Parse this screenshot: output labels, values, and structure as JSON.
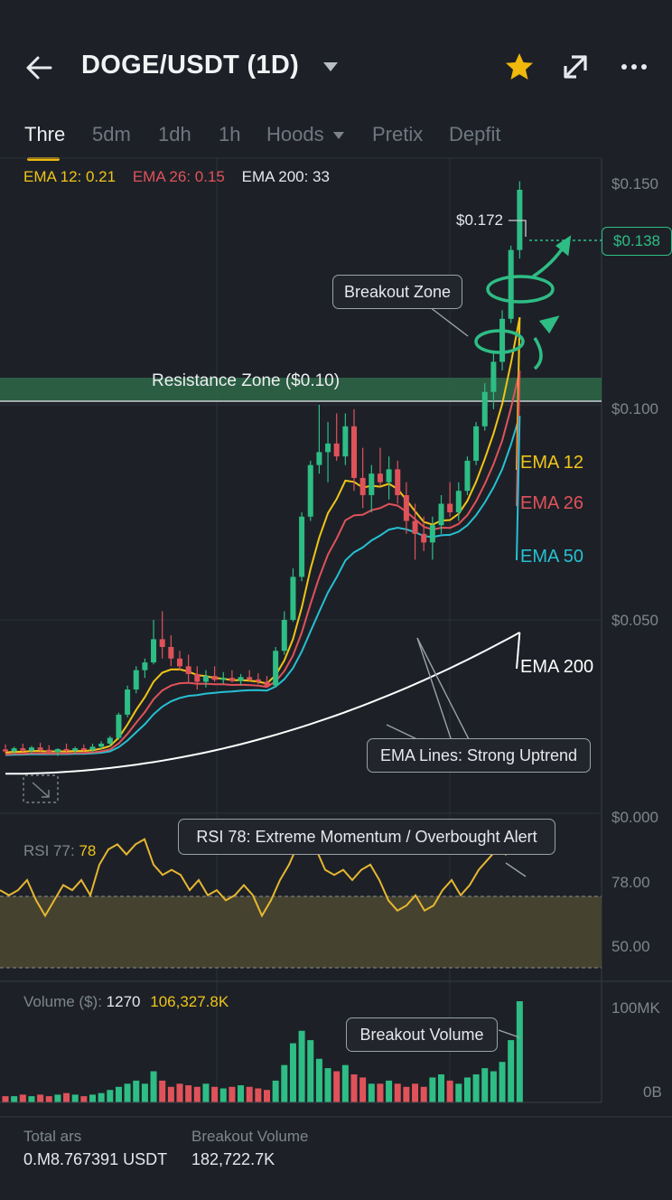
{
  "header": {
    "title": "DOGE/USDT (1D)",
    "icons": {
      "back": "arrow-left-icon",
      "dropdown": "chevron-down-icon",
      "favorite": "star-icon",
      "expand": "expand-arrow-icon",
      "more": "more-dots-icon"
    },
    "favorite_color": "#f0b90b"
  },
  "tabs": [
    {
      "label": "Thre",
      "active": true
    },
    {
      "label": "5dm",
      "active": false
    },
    {
      "label": "1dh",
      "active": false
    },
    {
      "label": "1h",
      "active": false
    },
    {
      "label": "Hoods",
      "active": false,
      "dropdown": true
    },
    {
      "label": "Pretix",
      "active": false
    },
    {
      "label": "Depfit",
      "active": false
    }
  ],
  "ema_legend": [
    {
      "text": "EMA 12: 0.21",
      "color": "#f0c419"
    },
    {
      "text": "EMA 26: 0.15",
      "color": "#e0525a"
    },
    {
      "text": "EMA 200: 33",
      "color": "#e6e8eb"
    }
  ],
  "price_axis": [
    "$0.150",
    "$0.100",
    "$0.050",
    "$0.000"
  ],
  "price_tag": "$0.138",
  "high_label": "$0.172",
  "resistance_label": "Resistance Zone ($0.10)",
  "callouts": {
    "breakout_zone": "Breakout Zone",
    "ema_lines": "EMA Lines: Strong Uptrend",
    "rsi_alert": "RSI 78: Extreme Momentum / Overbought Alert",
    "breakout_volume": "Breakout Volume"
  },
  "ema_labels": [
    {
      "text": "EMA 12",
      "color": "#f0c419"
    },
    {
      "text": "EMA 26",
      "color": "#e0525a"
    },
    {
      "text": "EMA 50",
      "color": "#26c0d3"
    },
    {
      "text": "EMA 200",
      "color": "#ffffff"
    }
  ],
  "rsi": {
    "label": "RSI 77:",
    "value": "78",
    "levels": [
      "78.00",
      "50.00"
    ],
    "values": [
      62,
      60,
      62,
      66,
      58,
      52,
      58,
      64,
      62,
      66,
      60,
      72,
      78,
      80,
      76,
      80,
      82,
      72,
      68,
      70,
      68,
      62,
      66,
      60,
      62,
      58,
      60,
      64,
      60,
      52,
      58,
      66,
      72,
      80,
      84,
      78,
      70,
      68,
      70,
      66,
      70,
      72,
      66,
      58,
      54,
      56,
      60,
      54,
      56,
      62,
      66,
      60,
      64,
      70,
      74,
      78,
      76,
      80,
      80
    ]
  },
  "volume": {
    "label": "Volume ($):",
    "value1": "1270",
    "value2": "106,327.8K",
    "axis": [
      "100MK",
      "0B"
    ]
  },
  "footer": {
    "total_label": "Total ars",
    "total_value": "0.M8.767391 USDT",
    "breakout_label": "Breakout Volume",
    "breakout_value": "182,722.7K"
  },
  "colors": {
    "up": "#2ebd85",
    "down": "#e0525a",
    "accent": "#f0b90b"
  },
  "chart_data": {
    "type": "candlestick",
    "y_range": [
      0.0,
      0.16
    ],
    "candles": [
      {
        "o": 0.0165,
        "h": 0.0178,
        "l": 0.0155,
        "c": 0.016
      },
      {
        "o": 0.016,
        "h": 0.0172,
        "l": 0.015,
        "c": 0.0168
      },
      {
        "o": 0.0168,
        "h": 0.018,
        "l": 0.0158,
        "c": 0.0162
      },
      {
        "o": 0.0162,
        "h": 0.0174,
        "l": 0.0154,
        "c": 0.017
      },
      {
        "o": 0.017,
        "h": 0.0182,
        "l": 0.016,
        "c": 0.0164
      },
      {
        "o": 0.0164,
        "h": 0.0176,
        "l": 0.0156,
        "c": 0.0158
      },
      {
        "o": 0.0158,
        "h": 0.0168,
        "l": 0.0148,
        "c": 0.0166
      },
      {
        "o": 0.0166,
        "h": 0.018,
        "l": 0.0158,
        "c": 0.0162
      },
      {
        "o": 0.0162,
        "h": 0.0172,
        "l": 0.0152,
        "c": 0.0168
      },
      {
        "o": 0.0168,
        "h": 0.0178,
        "l": 0.016,
        "c": 0.0164
      },
      {
        "o": 0.0164,
        "h": 0.018,
        "l": 0.0156,
        "c": 0.0172
      },
      {
        "o": 0.0172,
        "h": 0.0186,
        "l": 0.0166,
        "c": 0.018
      },
      {
        "o": 0.018,
        "h": 0.02,
        "l": 0.0172,
        "c": 0.0195
      },
      {
        "o": 0.0195,
        "h": 0.026,
        "l": 0.019,
        "c": 0.0255
      },
      {
        "o": 0.0255,
        "h": 0.033,
        "l": 0.0248,
        "c": 0.032
      },
      {
        "o": 0.032,
        "h": 0.038,
        "l": 0.031,
        "c": 0.037
      },
      {
        "o": 0.037,
        "h": 0.04,
        "l": 0.035,
        "c": 0.039
      },
      {
        "o": 0.039,
        "h": 0.05,
        "l": 0.0385,
        "c": 0.045
      },
      {
        "o": 0.045,
        "h": 0.052,
        "l": 0.04,
        "c": 0.043
      },
      {
        "o": 0.043,
        "h": 0.046,
        "l": 0.038,
        "c": 0.04
      },
      {
        "o": 0.04,
        "h": 0.042,
        "l": 0.037,
        "c": 0.038
      },
      {
        "o": 0.038,
        "h": 0.041,
        "l": 0.034,
        "c": 0.036
      },
      {
        "o": 0.036,
        "h": 0.038,
        "l": 0.032,
        "c": 0.034
      },
      {
        "o": 0.034,
        "h": 0.037,
        "l": 0.0325,
        "c": 0.0355
      },
      {
        "o": 0.0355,
        "h": 0.038,
        "l": 0.034,
        "c": 0.0345
      },
      {
        "o": 0.0345,
        "h": 0.0365,
        "l": 0.0335,
        "c": 0.035
      },
      {
        "o": 0.035,
        "h": 0.037,
        "l": 0.0338,
        "c": 0.0342
      },
      {
        "o": 0.0342,
        "h": 0.036,
        "l": 0.033,
        "c": 0.0352
      },
      {
        "o": 0.0352,
        "h": 0.037,
        "l": 0.034,
        "c": 0.0346
      },
      {
        "o": 0.0346,
        "h": 0.0362,
        "l": 0.0334,
        "c": 0.034
      },
      {
        "o": 0.034,
        "h": 0.0355,
        "l": 0.0325,
        "c": 0.033
      },
      {
        "o": 0.033,
        "h": 0.043,
        "l": 0.0325,
        "c": 0.042
      },
      {
        "o": 0.042,
        "h": 0.052,
        "l": 0.041,
        "c": 0.05
      },
      {
        "o": 0.05,
        "h": 0.062,
        "l": 0.0495,
        "c": 0.06
      },
      {
        "o": 0.06,
        "h": 0.075,
        "l": 0.059,
        "c": 0.074
      },
      {
        "o": 0.074,
        "h": 0.087,
        "l": 0.073,
        "c": 0.086
      },
      {
        "o": 0.086,
        "h": 0.1,
        "l": 0.084,
        "c": 0.089
      },
      {
        "o": 0.089,
        "h": 0.096,
        "l": 0.082,
        "c": 0.091
      },
      {
        "o": 0.091,
        "h": 0.098,
        "l": 0.087,
        "c": 0.088
      },
      {
        "o": 0.088,
        "h": 0.098,
        "l": 0.086,
        "c": 0.095
      },
      {
        "o": 0.095,
        "h": 0.099,
        "l": 0.08,
        "c": 0.083
      },
      {
        "o": 0.083,
        "h": 0.09,
        "l": 0.076,
        "c": 0.079
      },
      {
        "o": 0.079,
        "h": 0.086,
        "l": 0.075,
        "c": 0.084
      },
      {
        "o": 0.084,
        "h": 0.09,
        "l": 0.081,
        "c": 0.082
      },
      {
        "o": 0.082,
        "h": 0.088,
        "l": 0.078,
        "c": 0.085
      },
      {
        "o": 0.085,
        "h": 0.087,
        "l": 0.077,
        "c": 0.079
      },
      {
        "o": 0.079,
        "h": 0.082,
        "l": 0.07,
        "c": 0.073
      },
      {
        "o": 0.073,
        "h": 0.077,
        "l": 0.064,
        "c": 0.07
      },
      {
        "o": 0.07,
        "h": 0.074,
        "l": 0.066,
        "c": 0.068
      },
      {
        "o": 0.068,
        "h": 0.074,
        "l": 0.064,
        "c": 0.072
      },
      {
        "o": 0.072,
        "h": 0.079,
        "l": 0.07,
        "c": 0.077
      },
      {
        "o": 0.077,
        "h": 0.082,
        "l": 0.074,
        "c": 0.075
      },
      {
        "o": 0.075,
        "h": 0.082,
        "l": 0.073,
        "c": 0.08
      },
      {
        "o": 0.08,
        "h": 0.088,
        "l": 0.079,
        "c": 0.087
      },
      {
        "o": 0.087,
        "h": 0.096,
        "l": 0.086,
        "c": 0.095
      },
      {
        "o": 0.095,
        "h": 0.105,
        "l": 0.094,
        "c": 0.103
      },
      {
        "o": 0.103,
        "h": 0.112,
        "l": 0.099,
        "c": 0.11
      },
      {
        "o": 0.11,
        "h": 0.122,
        "l": 0.108,
        "c": 0.12
      },
      {
        "o": 0.12,
        "h": 0.137,
        "l": 0.119,
        "c": 0.136
      },
      {
        "o": 0.136,
        "h": 0.152,
        "l": 0.134,
        "c": 0.15
      }
    ],
    "volumes": [
      4,
      4,
      5,
      4,
      5,
      4,
      5,
      6,
      5,
      4,
      5,
      6,
      8,
      10,
      12,
      14,
      12,
      20,
      14,
      10,
      12,
      11,
      10,
      12,
      10,
      9,
      10,
      11,
      10,
      9,
      8,
      14,
      24,
      38,
      46,
      40,
      28,
      22,
      20,
      24,
      18,
      16,
      12,
      12,
      14,
      12,
      10,
      12,
      10,
      16,
      18,
      14,
      12,
      16,
      18,
      22,
      20,
      26,
      40,
      65
    ]
  }
}
